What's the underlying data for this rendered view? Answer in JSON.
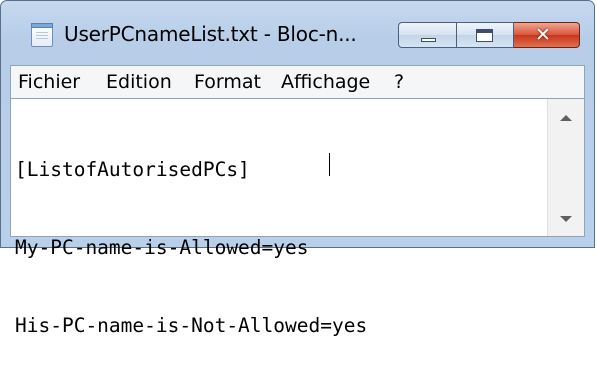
{
  "window": {
    "title": "UserPCnameList.txt - Bloc-n...",
    "controls": {
      "minimize": "minimize",
      "maximize": "maximize",
      "close_glyph": "✕"
    }
  },
  "menu": {
    "items": [
      "Fichier",
      "Edition",
      "Format",
      "Affichage",
      "?"
    ]
  },
  "editor": {
    "lines": [
      "[ListofAutorisedPCs]",
      "My-PC-name-is-Allowed=yes",
      "His-PC-name-is-Not-Allowed=yes"
    ]
  },
  "icons": {
    "app": "notepad-icon",
    "scroll_up": "scroll-up-arrow-icon",
    "scroll_down": "scroll-down-arrow-icon"
  },
  "colors": {
    "titlebar": "#b9d0ea",
    "close_button": "#d7543a",
    "menubar": "#f5f6f8",
    "editor_bg": "#ffffff"
  }
}
